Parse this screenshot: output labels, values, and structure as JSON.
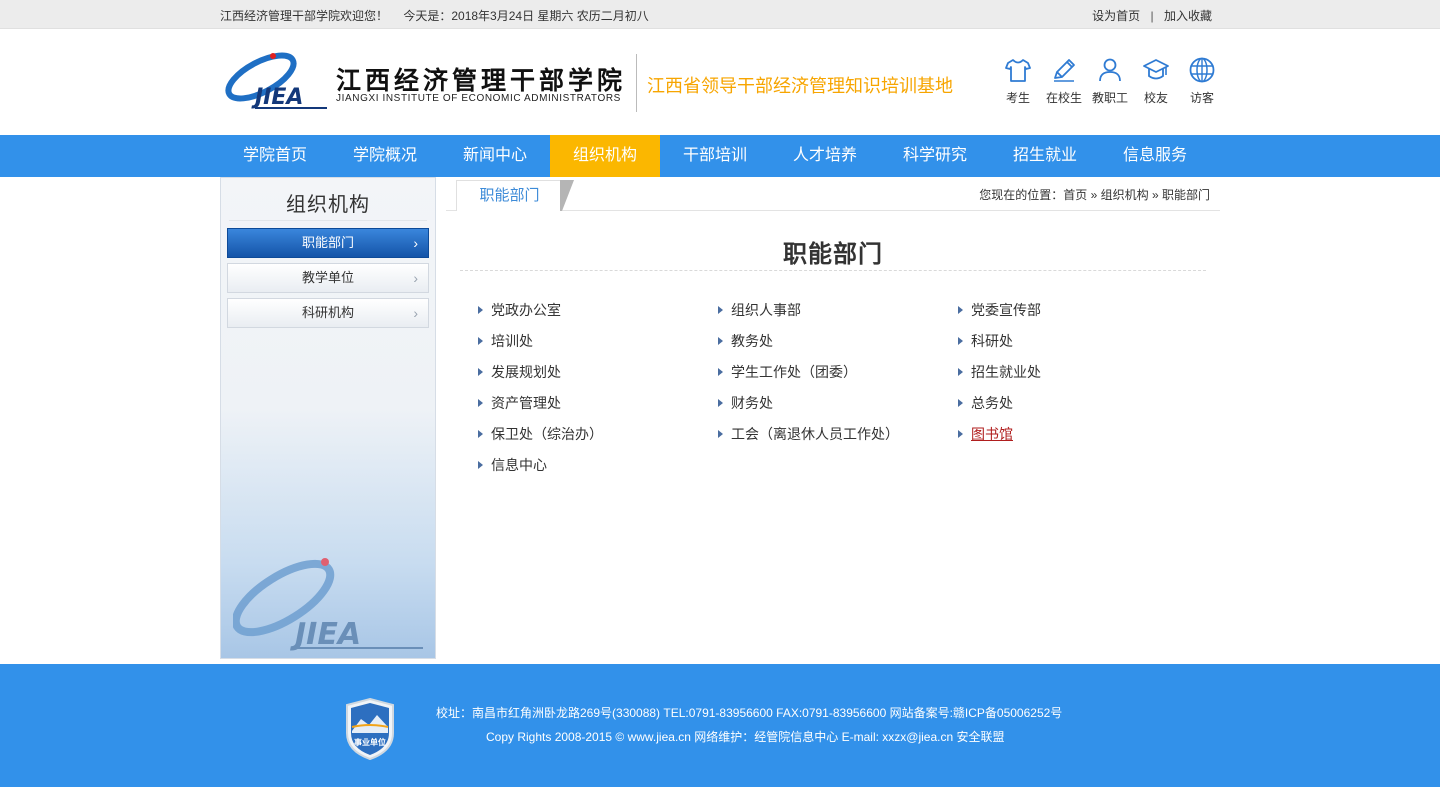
{
  "topbar": {
    "welcome": "江西经济管理干部学院欢迎您！",
    "date": "今天是：2018年3月24日 星期六 农历二月初八",
    "set_home": "设为首页",
    "separator": "|",
    "add_fav": "加入收藏"
  },
  "header": {
    "logo_text": "JIEA",
    "title": "江西经济管理干部学院",
    "subtitle": "JIANGXI INSTITUTE OF ECONOMIC ADMINISTRATORS",
    "slogan": "江西省领导干部经济管理知识培训基地",
    "quick_links": [
      {
        "label": "考生",
        "icon": "tshirt-icon"
      },
      {
        "label": "在校生",
        "icon": "pencil-icon"
      },
      {
        "label": "教职工",
        "icon": "person-icon"
      },
      {
        "label": "校友",
        "icon": "graduation-cap-icon"
      },
      {
        "label": "访客",
        "icon": "globe-icon"
      }
    ]
  },
  "nav": {
    "items": [
      "学院首页",
      "学院概况",
      "新闻中心",
      "组织机构",
      "干部培训",
      "人才培养",
      "科学研究",
      "招生就业",
      "信息服务"
    ],
    "active_index": 3,
    "accent_color": "#3291ea",
    "active_color": "#fbb700"
  },
  "sidebar": {
    "title": "组织机构",
    "items": [
      {
        "label": "职能部门",
        "active": true
      },
      {
        "label": "教学单位",
        "active": false
      },
      {
        "label": "科研机构",
        "active": false
      }
    ],
    "logo_text": "JIEA"
  },
  "content": {
    "tab": "职能部门",
    "breadcrumb": {
      "prefix": "您现在的位置：",
      "items": [
        "首页",
        "组织机构",
        "职能部门"
      ],
      "sep": "»"
    },
    "title": "职能部门",
    "departments": [
      [
        "党政办公室",
        "组织人事部",
        "党委宣传部"
      ],
      [
        "培训处",
        "教务处",
        "科研处"
      ],
      [
        "发展规划处",
        "学生工作处（团委）",
        "招生就业处"
      ],
      [
        "资产管理处",
        "财务处",
        "总务处"
      ],
      [
        "保卫处（综治办）",
        "工会（离退休人员工作处）",
        "图书馆"
      ],
      [
        "信息中心"
      ]
    ],
    "highlighted": "图书馆"
  },
  "footer": {
    "badge_text": "事业单位",
    "line1": "校址：南昌市红角洲卧龙路269号(330088) TEL:0791-83956600 FAX:0791-83956600 网站备案号:赣ICP备05006252号",
    "line2": "Copy Rights 2008-2015 © www.jiea.cn 网络维护：经管院信息中心 E-mail: xxzx@jiea.cn 安全联盟"
  }
}
